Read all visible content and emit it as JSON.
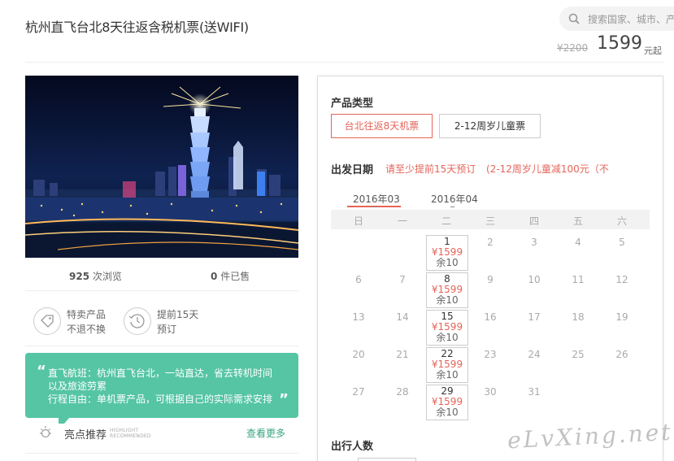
{
  "header": {
    "title": "杭州直飞台北8天往返含税机票(送WIFI)",
    "search_placeholder": "搜索国家、城市、产",
    "old_price": "¥2200",
    "price": "1599",
    "price_unit": "元起"
  },
  "stats": {
    "views_count": "925",
    "views_label": "次浏览",
    "sold_count": "0",
    "sold_label": "件已售"
  },
  "features": [
    {
      "line1": "特卖产品",
      "line2": "不退不换",
      "icon": "tag-icon"
    },
    {
      "line1": "提前15天",
      "line2": "预订",
      "icon": "clock-icon"
    }
  ],
  "highlight": {
    "line1": "直飞航班：杭州直飞台北，一站直达，省去转机时间",
    "line2": "以及旅途劳累",
    "line3": "行程自由：单机票产品，可根据自己的实际需求安排",
    "label": "亮点推荐",
    "label_en_1": "HIGHLIGHT",
    "label_en_2": "RECOMMENDED",
    "more": "查看更多"
  },
  "product_type": {
    "label": "产品类型",
    "options": [
      "台北往返8天机票",
      "2-12周岁儿童票"
    ],
    "selected": 0
  },
  "departure": {
    "label": "出发日期",
    "note1": "请至少提前15天预订",
    "note2": "(2-12周岁儿童减100元（不"
  },
  "calendar": {
    "months": [
      "2016年03",
      "2016年04"
    ],
    "active_month": 0,
    "weekdays": [
      "日",
      "一",
      "二",
      "三",
      "四",
      "五",
      "六"
    ],
    "weeks": [
      [
        "",
        "",
        "1",
        "2",
        "3",
        "4",
        "5"
      ],
      [
        "6",
        "7",
        "8",
        "9",
        "10",
        "11",
        "12"
      ],
      [
        "13",
        "14",
        "15",
        "16",
        "17",
        "18",
        "19"
      ],
      [
        "20",
        "21",
        "22",
        "23",
        "24",
        "25",
        "26"
      ],
      [
        "27",
        "28",
        "29",
        "30",
        "31",
        "",
        ""
      ]
    ],
    "available": [
      {
        "day": "1",
        "price": "¥1599",
        "remain": "余10"
      },
      {
        "day": "8",
        "price": "¥1599",
        "remain": "余10"
      },
      {
        "day": "15",
        "price": "¥1599",
        "remain": "余10"
      },
      {
        "day": "22",
        "price": "¥1599",
        "remain": "余10"
      },
      {
        "day": "29",
        "price": "¥1599",
        "remain": "余10"
      }
    ]
  },
  "travelers": {
    "label": "出行人数"
  },
  "watermark": "eLvXing.net",
  "colors": {
    "accent": "#e5645a",
    "green": "#55c5a3",
    "link_green": "#3aa57f"
  }
}
